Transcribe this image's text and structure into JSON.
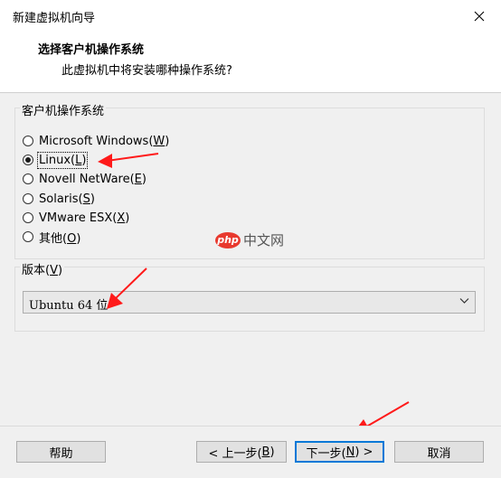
{
  "window": {
    "title": "新建虚拟机向导"
  },
  "header": {
    "title": "选择客户机操作系统",
    "subtitle": "此虚拟机中将安装哪种操作系统?"
  },
  "os_group": {
    "legend": "客户机操作系统",
    "options": [
      {
        "text": "Microsoft Windows(",
        "key": "W",
        "end": ")",
        "checked": false
      },
      {
        "text": "Linux(",
        "key": "L",
        "end": ")",
        "checked": true
      },
      {
        "text": "Novell NetWare(",
        "key": "E",
        "end": ")",
        "checked": false
      },
      {
        "text": "Solaris(",
        "key": "S",
        "end": ")",
        "checked": false
      },
      {
        "text": "VMware ESX(",
        "key": "X",
        "end": ")",
        "checked": false
      },
      {
        "text": "其他(",
        "key": "O",
        "end": ")",
        "checked": false
      }
    ]
  },
  "version_group": {
    "legend_text": "版本(",
    "legend_key": "V",
    "legend_end": ")",
    "selected": "Ubuntu 64 位"
  },
  "watermark": {
    "badge": "php",
    "text": "中文网"
  },
  "footer": {
    "help": "帮助",
    "back_text": "< 上一步(",
    "back_key": "B",
    "back_end": ")",
    "next_text": "下一步(",
    "next_key": "N",
    "next_end": ") >",
    "cancel": "取消"
  },
  "colors": {
    "accent": "#0078d7",
    "annotation_arrow": "#ff1a1a",
    "panel_bg": "#f0f0f0"
  },
  "icons": {
    "close": "close-icon",
    "dropdown": "chevron-down-icon",
    "arrow": "arrow-annotation-icon"
  }
}
